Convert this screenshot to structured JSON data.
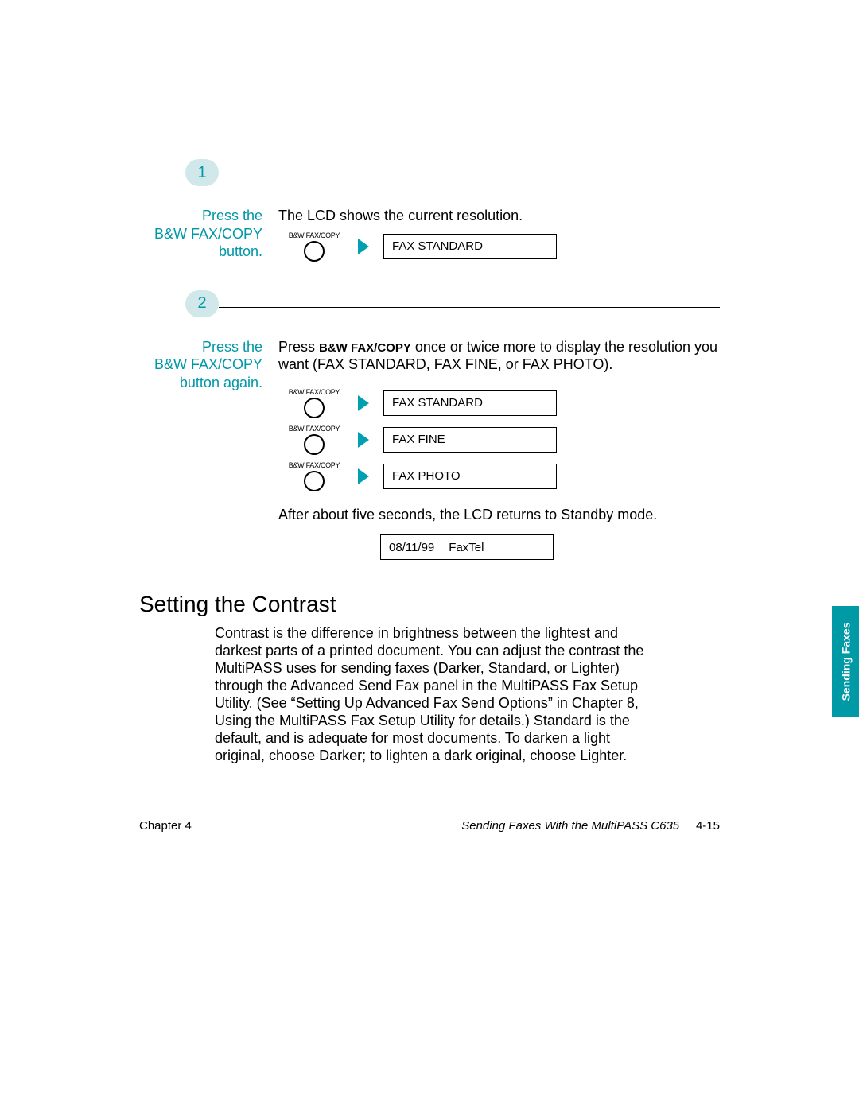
{
  "step1": {
    "number": "1",
    "instr_line1": "Press the",
    "instr_button": "B&W FAX/COPY",
    "instr_line3": "button.",
    "desc": "The LCD shows the current resolution.",
    "button_label": "B&W FAX/COPY",
    "lcd": "FAX STANDARD"
  },
  "step2": {
    "number": "2",
    "instr_line1": "Press the",
    "instr_button": "B&W FAX/COPY",
    "instr_line3": "button again.",
    "desc_pre": "Press ",
    "desc_bold": "B&W FAX/COPY",
    "desc_post": " once or twice more to display the resolution you want (FAX STANDARD, FAX FINE, or FAX PHOTO).",
    "button_label": "B&W FAX/COPY",
    "lcds": [
      "FAX STANDARD",
      "FAX FINE",
      "FAX PHOTO"
    ],
    "after_text": "After about five seconds, the LCD returns to Standby mode.",
    "standby_date": "08/11/99",
    "standby_mode": "FaxTel"
  },
  "contrast": {
    "heading": "Setting the Contrast",
    "body": "Contrast is the difference in brightness between the lightest and darkest parts of a printed document. You can adjust the contrast the MultiPASS uses for sending faxes (Darker, Standard, or Lighter) through the Advanced Send Fax panel in the MultiPASS Fax Setup Utility. (See “Setting Up Advanced Fax Send Options” in Chapter 8, Using the MultiPASS Fax Setup Utility for details.) Standard is the default, and is adequate for most documents. To darken a light original, choose Darker; to lighten a dark original, choose Lighter."
  },
  "sidetab": "Sending Faxes",
  "footer": {
    "left": "Chapter 4",
    "right_title": "Sending Faxes With the MultiPASS C635",
    "right_page": "4-15"
  }
}
